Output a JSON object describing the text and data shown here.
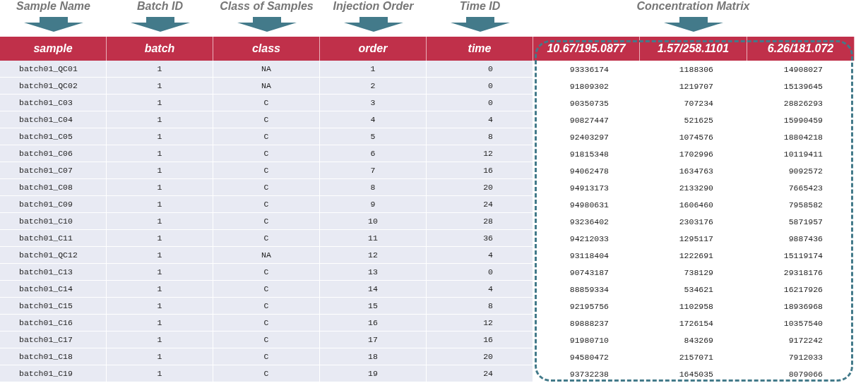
{
  "annotations": [
    {
      "label": "Sample Name"
    },
    {
      "label": "Batch ID"
    },
    {
      "label": "Class of Samples"
    },
    {
      "label": "Injection Order"
    },
    {
      "label": "Time ID"
    },
    {
      "label": "Concentration Matrix"
    }
  ],
  "table": {
    "id_columns": [
      "sample",
      "batch",
      "class",
      "order",
      "time"
    ],
    "matrix_columns": [
      "10.67/195.0877",
      "1.57/258.1101",
      "6.26/181.072"
    ],
    "rows": [
      {
        "ids": [
          "batch01_QC01",
          "1",
          "NA",
          "1",
          "0"
        ],
        "values": [
          "93336174",
          "1188306",
          "14908027"
        ]
      },
      {
        "ids": [
          "batch01_QC02",
          "1",
          "NA",
          "2",
          "0"
        ],
        "values": [
          "91809302",
          "1219707",
          "15139645"
        ]
      },
      {
        "ids": [
          "batch01_C03",
          "1",
          "C",
          "3",
          "0"
        ],
        "values": [
          "90350735",
          "707234",
          "28826293"
        ]
      },
      {
        "ids": [
          "batch01_C04",
          "1",
          "C",
          "4",
          "4"
        ],
        "values": [
          "90827447",
          "521625",
          "15990459"
        ]
      },
      {
        "ids": [
          "batch01_C05",
          "1",
          "C",
          "5",
          "8"
        ],
        "values": [
          "92403297",
          "1074576",
          "18804218"
        ]
      },
      {
        "ids": [
          "batch01_C06",
          "1",
          "C",
          "6",
          "12"
        ],
        "values": [
          "91815348",
          "1702996",
          "10119411"
        ]
      },
      {
        "ids": [
          "batch01_C07",
          "1",
          "C",
          "7",
          "16"
        ],
        "values": [
          "94062478",
          "1634763",
          "9092572"
        ]
      },
      {
        "ids": [
          "batch01_C08",
          "1",
          "C",
          "8",
          "20"
        ],
        "values": [
          "94913173",
          "2133290",
          "7665423"
        ]
      },
      {
        "ids": [
          "batch01_C09",
          "1",
          "C",
          "9",
          "24"
        ],
        "values": [
          "94980631",
          "1606460",
          "7958582"
        ]
      },
      {
        "ids": [
          "batch01_C10",
          "1",
          "C",
          "10",
          "28"
        ],
        "values": [
          "93236402",
          "2303176",
          "5871957"
        ]
      },
      {
        "ids": [
          "batch01_C11",
          "1",
          "C",
          "11",
          "36"
        ],
        "values": [
          "94212033",
          "1295117",
          "9887436"
        ]
      },
      {
        "ids": [
          "batch01_QC12",
          "1",
          "NA",
          "12",
          "4"
        ],
        "values": [
          "93118404",
          "1222691",
          "15119174"
        ]
      },
      {
        "ids": [
          "batch01_C13",
          "1",
          "C",
          "13",
          "0"
        ],
        "values": [
          "90743187",
          "738129",
          "29318176"
        ]
      },
      {
        "ids": [
          "batch01_C14",
          "1",
          "C",
          "14",
          "4"
        ],
        "values": [
          "88859334",
          "534621",
          "16217926"
        ]
      },
      {
        "ids": [
          "batch01_C15",
          "1",
          "C",
          "15",
          "8"
        ],
        "values": [
          "92195756",
          "1102958",
          "18936968"
        ]
      },
      {
        "ids": [
          "batch01_C16",
          "1",
          "C",
          "16",
          "12"
        ],
        "values": [
          "89888237",
          "1726154",
          "10357540"
        ]
      },
      {
        "ids": [
          "batch01_C17",
          "1",
          "C",
          "17",
          "16"
        ],
        "values": [
          "91980710",
          "843269",
          "9172242"
        ]
      },
      {
        "ids": [
          "batch01_C18",
          "1",
          "C",
          "18",
          "20"
        ],
        "values": [
          "94580472",
          "2157071",
          "7912033"
        ]
      },
      {
        "ids": [
          "batch01_C19",
          "1",
          "C",
          "19",
          "24"
        ],
        "values": [
          "93732238",
          "1645035",
          "8079066"
        ]
      }
    ]
  }
}
